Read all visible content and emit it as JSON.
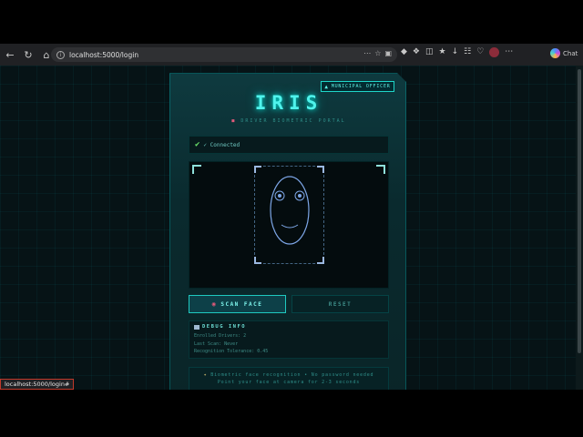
{
  "browser": {
    "url": "localhost:5000/login",
    "copilot_label": "Chat",
    "status_link": "localhost:5000/login#"
  },
  "portal": {
    "badge_label": "MUNICIPAL OFFICER",
    "title": "IRIS",
    "subtitle": "DRIVER BIOMETRIC PORTAL",
    "status_text": "✓ Connected",
    "scan_button": "SCAN FACE",
    "reset_button": "RESET",
    "debug": {
      "title": "DEBUG INFO",
      "lines": [
        "Enrolled Drivers: 2",
        "Last Scan: Never",
        "Recognition Tolerance: 0.45"
      ]
    },
    "hint": {
      "line1": "Biometric face recognition • No password needed",
      "line2": "Point your face at camera for 2-3 seconds"
    }
  },
  "colors": {
    "accent": "#4ff3ec",
    "panel": "#0e3a3f",
    "background": "#061316"
  }
}
